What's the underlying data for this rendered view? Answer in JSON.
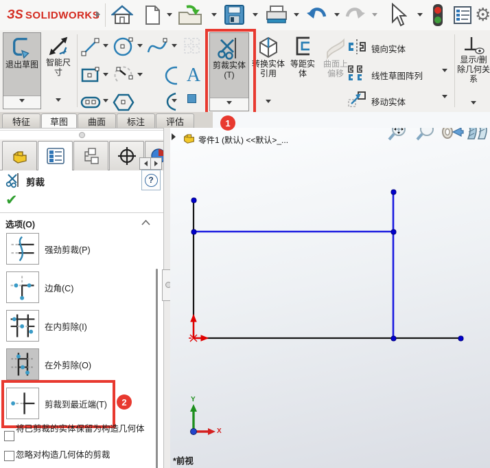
{
  "topbar": {
    "logo_mark": "ЗS",
    "brand": "SOLIDWORKS"
  },
  "ribbon": {
    "exit_sketch": "退出草图",
    "smart_dimension": "智能尺寸",
    "text_tool": "A",
    "trim": "剪裁实体(T)",
    "convert_entities": "转换实体引用",
    "offset_entities": "等距实体",
    "surface_offset": "曲面上偏移",
    "mirror_entities": "镜向实体",
    "linear_pattern": "线性草图阵列",
    "move_entities": "移动实体",
    "display_relations": "显示/删除几何关系"
  },
  "tabs": {
    "features": "特征",
    "sketch": "草图",
    "surfaces": "曲面",
    "annotations": "标注",
    "evaluate": "评估"
  },
  "panel": {
    "title": "剪裁",
    "help": "?",
    "options_header": "选项(O)",
    "options": [
      "强劲剪裁(P)",
      "边角(C)",
      "在内剪除(I)",
      "在外剪除(O)",
      "剪裁到最近端(T)"
    ],
    "keep_as_construction": "将已剪裁的实体保留为构造几何体",
    "ignore_construction": "忽略对构造几何体的剪裁"
  },
  "viewport": {
    "tree_item": "零件1 (默认) <<默认>_...",
    "view_label": "*前视",
    "axis_x": "X",
    "axis_y": "Y"
  },
  "annotations": {
    "step1": "1",
    "step2": "2"
  },
  "colors": {
    "annotation_red": "#e8392f",
    "sketch_blue": "#1a1ae0",
    "brand_red": "#d42a1f"
  }
}
